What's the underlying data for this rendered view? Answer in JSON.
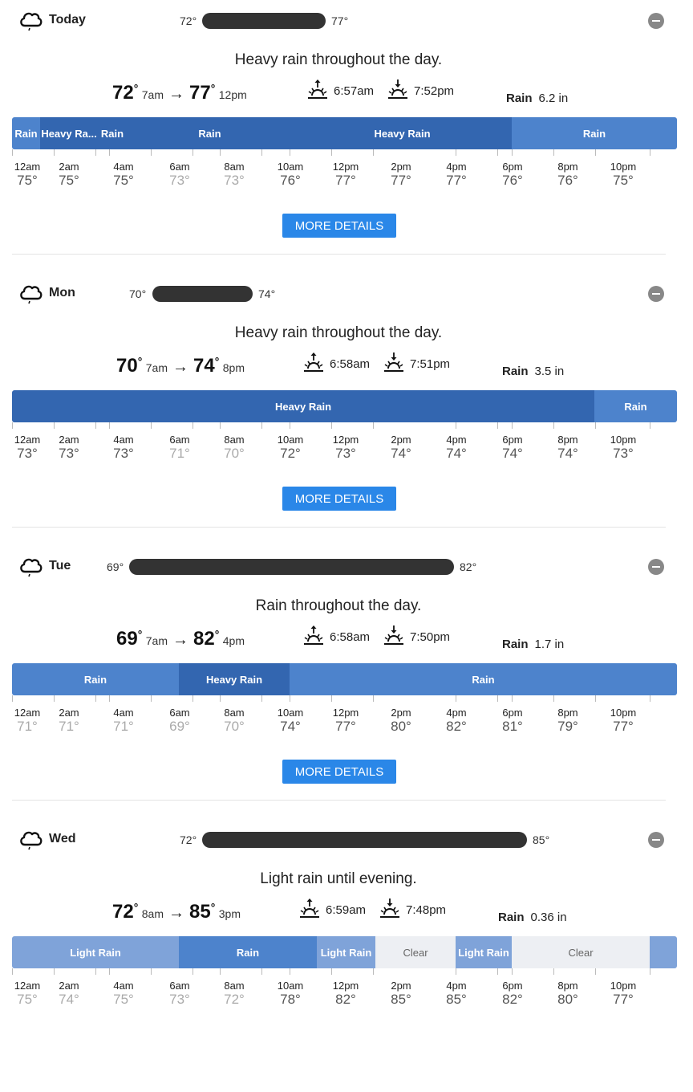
{
  "colors": {
    "heavy_rain": "#3366b0",
    "rain": "#4d83cc",
    "light_rain": "#7fa3d9",
    "clear": "#edeff3",
    "button": "#2a87e8",
    "range_bar": "#333333"
  },
  "days": [
    {
      "name": "Today",
      "low": "72°",
      "high": "77°",
      "summary": "Heavy rain throughout the day.",
      "low_big": "72",
      "low_time": "7am",
      "high_big": "77",
      "high_time": "12pm",
      "sunrise": "6:57am",
      "sunset": "7:52pm",
      "rain_label": "Rain",
      "rain_amount": "6.2 in",
      "segments": [
        {
          "label": "Rain",
          "type": "rain"
        },
        {
          "label": "Heavy Ra...",
          "type": "heavy_rain"
        },
        {
          "label": "Rain",
          "type": "heavy_rain"
        },
        {
          "label": "Rain",
          "type": "heavy_rain"
        },
        {
          "label": "Heavy Rain",
          "type": "heavy_rain"
        },
        {
          "label": "Rain",
          "type": "rain"
        }
      ],
      "hours": [
        {
          "h": "12am",
          "t": "75°"
        },
        {
          "h": "2am",
          "t": "75°"
        },
        {
          "h": "4am",
          "t": "75°"
        },
        {
          "h": "6am",
          "t": "73°"
        },
        {
          "h": "8am",
          "t": "73°"
        },
        {
          "h": "10am",
          "t": "76°"
        },
        {
          "h": "12pm",
          "t": "77°"
        },
        {
          "h": "2pm",
          "t": "77°"
        },
        {
          "h": "4pm",
          "t": "77°"
        },
        {
          "h": "6pm",
          "t": "76°"
        },
        {
          "h": "8pm",
          "t": "76°"
        },
        {
          "h": "10pm",
          "t": "75°"
        }
      ],
      "button": "MORE DETAILS"
    },
    {
      "name": "Mon",
      "low": "70°",
      "high": "74°",
      "summary": "Heavy rain throughout the day.",
      "low_big": "70",
      "low_time": "7am",
      "high_big": "74",
      "high_time": "8pm",
      "sunrise": "6:58am",
      "sunset": "7:51pm",
      "rain_label": "Rain",
      "rain_amount": "3.5 in",
      "segments": [
        {
          "label": "Heavy Rain",
          "type": "heavy_rain"
        },
        {
          "label": "Rain",
          "type": "rain"
        }
      ],
      "hours": [
        {
          "h": "12am",
          "t": "73°"
        },
        {
          "h": "2am",
          "t": "73°"
        },
        {
          "h": "4am",
          "t": "73°"
        },
        {
          "h": "6am",
          "t": "71°"
        },
        {
          "h": "8am",
          "t": "70°"
        },
        {
          "h": "10am",
          "t": "72°"
        },
        {
          "h": "12pm",
          "t": "73°"
        },
        {
          "h": "2pm",
          "t": "74°"
        },
        {
          "h": "4pm",
          "t": "74°"
        },
        {
          "h": "6pm",
          "t": "74°"
        },
        {
          "h": "8pm",
          "t": "74°"
        },
        {
          "h": "10pm",
          "t": "73°"
        }
      ],
      "button": "MORE DETAILS"
    },
    {
      "name": "Tue",
      "low": "69°",
      "high": "82°",
      "summary": "Rain throughout the day.",
      "low_big": "69",
      "low_time": "7am",
      "high_big": "82",
      "high_time": "4pm",
      "sunrise": "6:58am",
      "sunset": "7:50pm",
      "rain_label": "Rain",
      "rain_amount": "1.7 in",
      "segments": [
        {
          "label": "Rain",
          "type": "rain"
        },
        {
          "label": "Heavy Rain",
          "type": "heavy_rain"
        },
        {
          "label": "Rain",
          "type": "rain"
        }
      ],
      "hours": [
        {
          "h": "12am",
          "t": "71°"
        },
        {
          "h": "2am",
          "t": "71°"
        },
        {
          "h": "4am",
          "t": "71°"
        },
        {
          "h": "6am",
          "t": "69°"
        },
        {
          "h": "8am",
          "t": "70°"
        },
        {
          "h": "10am",
          "t": "74°"
        },
        {
          "h": "12pm",
          "t": "77°"
        },
        {
          "h": "2pm",
          "t": "80°"
        },
        {
          "h": "4pm",
          "t": "82°"
        },
        {
          "h": "6pm",
          "t": "81°"
        },
        {
          "h": "8pm",
          "t": "79°"
        },
        {
          "h": "10pm",
          "t": "77°"
        }
      ],
      "button": "MORE DETAILS"
    },
    {
      "name": "Wed",
      "low": "72°",
      "high": "85°",
      "summary": "Light rain until evening.",
      "low_big": "72",
      "low_time": "8am",
      "high_big": "85",
      "high_time": "3pm",
      "sunrise": "6:59am",
      "sunset": "7:48pm",
      "rain_label": "Rain",
      "rain_amount": "0.36 in",
      "segments": [
        {
          "label": "Light Rain",
          "type": "light_rain"
        },
        {
          "label": "Rain",
          "type": "rain"
        },
        {
          "label": "Light Rain",
          "type": "light_rain"
        },
        {
          "label": "Clear",
          "type": "clear"
        },
        {
          "label": "Light Rain",
          "type": "light_rain"
        },
        {
          "label": "Clear",
          "type": "clear"
        },
        {
          "label": "",
          "type": "light_rain"
        }
      ],
      "hours": [
        {
          "h": "12am",
          "t": "75°"
        },
        {
          "h": "2am",
          "t": "74°"
        },
        {
          "h": "4am",
          "t": "75°"
        },
        {
          "h": "6am",
          "t": "73°"
        },
        {
          "h": "8am",
          "t": "72°"
        },
        {
          "h": "10am",
          "t": "78°"
        },
        {
          "h": "12pm",
          "t": "82°"
        },
        {
          "h": "2pm",
          "t": "85°"
        },
        {
          "h": "4pm",
          "t": "85°"
        },
        {
          "h": "6pm",
          "t": "82°"
        },
        {
          "h": "8pm",
          "t": "80°"
        },
        {
          "h": "10pm",
          "t": "77°"
        }
      ]
    }
  ]
}
